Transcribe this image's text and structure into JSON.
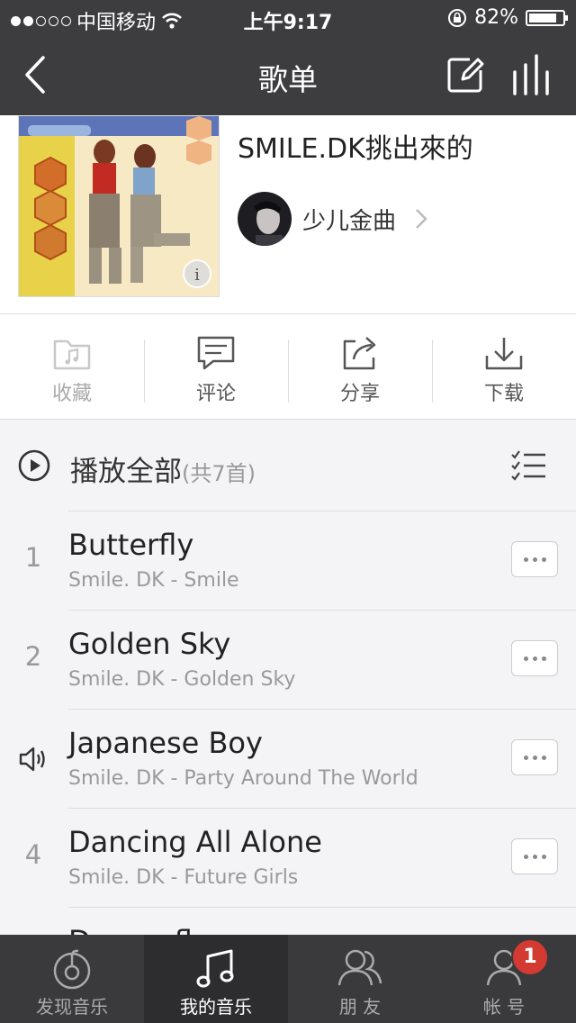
{
  "status_bar": {
    "carrier": "中国移动",
    "time": "上午9:17",
    "battery_text": "82%",
    "battery_level": 0.82
  },
  "nav": {
    "title": "歌单",
    "back_icon": "chevron-left-icon",
    "edit_icon": "edit-icon",
    "equalizer_icon": "equalizer-icon"
  },
  "playlist": {
    "title": "SMILE.DK挑出來的",
    "creator": "少儿金曲"
  },
  "actions": [
    {
      "label": "收藏",
      "icon": "folder-music-icon",
      "enabled": false
    },
    {
      "label": "评论",
      "icon": "comment-icon",
      "enabled": true
    },
    {
      "label": "分享",
      "icon": "share-icon",
      "enabled": true
    },
    {
      "label": "下载",
      "icon": "download-icon",
      "enabled": true
    }
  ],
  "play_all": {
    "label": "播放全部",
    "count": "(共7首)"
  },
  "songs": [
    {
      "index": "1",
      "title": "Butterfly",
      "subtitle": "Smile. DK - Smile",
      "playing": false
    },
    {
      "index": "2",
      "title": "Golden Sky",
      "subtitle": "Smile. DK - Golden Sky",
      "playing": false
    },
    {
      "index": "",
      "title": "Japanese Boy",
      "subtitle": "Smile. DK - Party Around The World",
      "playing": true
    },
    {
      "index": "4",
      "title": "Dancing All Alone",
      "subtitle": "Smile. DK - Future Girls",
      "playing": false
    },
    {
      "index": "",
      "title": "Dragonfly",
      "subtitle": "",
      "playing": false
    }
  ],
  "tabs": [
    {
      "label": "发现音乐",
      "icon": "discover-music-icon",
      "active": false
    },
    {
      "label": "我的音乐",
      "icon": "music-note-icon",
      "active": true
    },
    {
      "label": "朋 友",
      "icon": "friends-icon",
      "active": false
    },
    {
      "label": "帐 号",
      "icon": "account-icon",
      "active": false,
      "badge": "1"
    }
  ],
  "colors": {
    "bar": "#3d3d3f",
    "badge": "#d33a31",
    "background": "#f4f4f6"
  }
}
